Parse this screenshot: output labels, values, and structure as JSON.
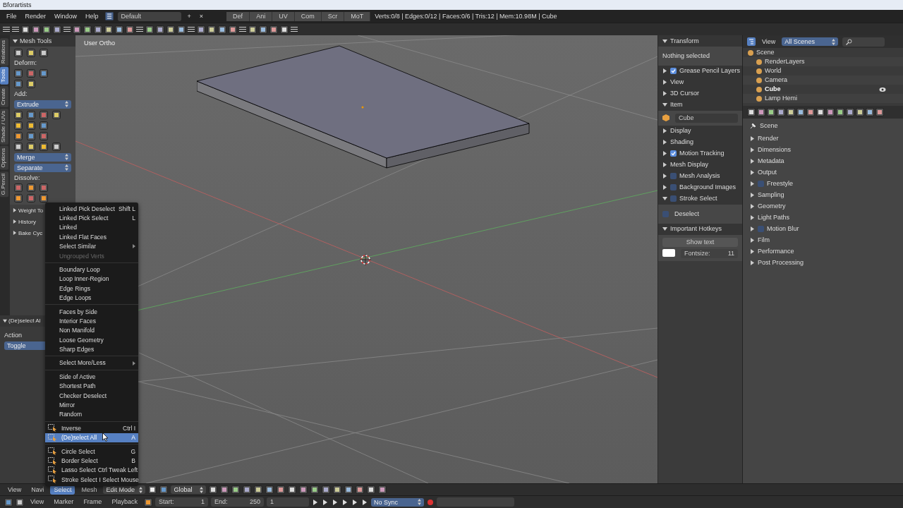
{
  "window": {
    "title": "Bforartists"
  },
  "menu_bar": {
    "menus": [
      "File",
      "Render",
      "Window",
      "Help"
    ],
    "layout": "Default",
    "layout_buttons": [
      "+",
      "×"
    ],
    "tabs": [
      {
        "label": "Def",
        "selected": false
      },
      {
        "label": "Ani",
        "selected": false
      },
      {
        "label": "UV",
        "selected": false
      },
      {
        "label": "Com",
        "selected": false
      },
      {
        "label": "Scr",
        "selected": false
      },
      {
        "label": "MoT",
        "selected": false
      }
    ],
    "stats": "Verts:0/8 | Edges:0/12 | Faces:0/6 | Tris:12 | Mem:10.98M | Cube"
  },
  "tool_shelf": {
    "tabs": [
      {
        "label": "Relations",
        "selected": false
      },
      {
        "label": "Tools",
        "selected": true
      },
      {
        "label": "Create",
        "selected": false
      },
      {
        "label": "Shade / UVs",
        "selected": false
      },
      {
        "label": "Options",
        "selected": false
      },
      {
        "label": "G.Pencil",
        "selected": false
      }
    ],
    "panel": {
      "title": "Mesh Tools",
      "expanded": true
    },
    "deform_label": "Deform:",
    "add_label": "Add:",
    "extrude": "Extrude",
    "merge": "Merge",
    "separate": "Separate",
    "dissolve_label": "Dissolve:",
    "collapsed_panels": [
      {
        "title": "Weight To",
        "expanded": false
      },
      {
        "title": "History",
        "expanded": false
      },
      {
        "title": "Bake Cyc",
        "expanded": false
      }
    ],
    "operator": {
      "title": "(De)select Al",
      "expanded": true,
      "action_label": "Action",
      "action": "Toggle"
    }
  },
  "viewport": {
    "label": "User Ortho"
  },
  "select_menu": {
    "groups": [
      [
        {
          "label": "Linked Pick Deselect",
          "shortcut": "Shift L",
          "kind": "command",
          "icon": false,
          "disabled": false,
          "selected": false
        },
        {
          "label": "Linked Pick Select",
          "shortcut": "L",
          "kind": "command",
          "icon": false,
          "disabled": false,
          "selected": false
        },
        {
          "label": "Linked",
          "kind": "command",
          "icon": false,
          "disabled": false,
          "selected": false
        },
        {
          "label": "Linked Flat Faces",
          "kind": "command",
          "icon": false,
          "disabled": false,
          "selected": false
        },
        {
          "label": "Select Similar",
          "kind": "submenu",
          "icon": false,
          "disabled": false,
          "selected": false
        },
        {
          "label": "Ungrouped Verts",
          "kind": "command",
          "icon": false,
          "disabled": true,
          "selected": false
        }
      ],
      [
        {
          "label": "Boundary Loop",
          "kind": "command",
          "icon": false,
          "disabled": false,
          "selected": false
        },
        {
          "label": "Loop Inner-Region",
          "kind": "command",
          "icon": false,
          "disabled": false,
          "selected": false
        },
        {
          "label": "Edge Rings",
          "kind": "command",
          "icon": false,
          "disabled": false,
          "selected": false
        },
        {
          "label": "Edge Loops",
          "kind": "command",
          "icon": false,
          "disabled": false,
          "selected": false
        }
      ],
      [
        {
          "label": "Faces by Side",
          "kind": "command",
          "icon": false,
          "disabled": false,
          "selected": false
        },
        {
          "label": "Interior Faces",
          "kind": "command",
          "icon": false,
          "disabled": false,
          "selected": false
        },
        {
          "label": "Non Manifold",
          "kind": "command",
          "icon": false,
          "disabled": false,
          "selected": false
        },
        {
          "label": "Loose Geometry",
          "kind": "command",
          "icon": false,
          "disabled": false,
          "selected": false
        },
        {
          "label": "Sharp Edges",
          "kind": "command",
          "icon": false,
          "disabled": false,
          "selected": false
        }
      ],
      [
        {
          "label": "Select More/Less",
          "kind": "submenu",
          "icon": false,
          "disabled": false,
          "selected": false
        }
      ],
      [
        {
          "label": "Side of Active",
          "kind": "command",
          "icon": false,
          "disabled": false,
          "selected": false
        },
        {
          "label": "Shortest Path",
          "kind": "command",
          "icon": false,
          "disabled": false,
          "selected": false
        },
        {
          "label": "Checker Deselect",
          "kind": "command",
          "icon": false,
          "disabled": false,
          "selected": false
        },
        {
          "label": "Mirror",
          "kind": "command",
          "icon": false,
          "disabled": false,
          "selected": false
        },
        {
          "label": "Random",
          "kind": "command",
          "icon": false,
          "disabled": false,
          "selected": false
        }
      ],
      [
        {
          "label": "Inverse",
          "shortcut": "Ctrl I",
          "kind": "command",
          "icon": true,
          "disabled": false,
          "selected": false
        },
        {
          "label": "(De)select All",
          "shortcut": "A",
          "kind": "command",
          "icon": true,
          "disabled": false,
          "selected": true
        }
      ],
      [
        {
          "label": "Circle Select",
          "shortcut": "G",
          "kind": "command",
          "icon": true,
          "disabled": false,
          "selected": false
        },
        {
          "label": "Border Select",
          "shortcut": "B",
          "kind": "command",
          "icon": true,
          "disabled": false,
          "selected": false
        },
        {
          "label": "Lasso Select",
          "shortcut": "Ctrl Tweak Left",
          "kind": "command",
          "icon": true,
          "disabled": false,
          "selected": false
        },
        {
          "label": "Stroke Select",
          "shortcut": "I Select Mouse",
          "kind": "command",
          "icon": true,
          "disabled": false,
          "selected": false
        }
      ]
    ]
  },
  "n_panel": {
    "panels": [
      {
        "title": "Transform",
        "expanded": true,
        "kind": "text",
        "text": "Nothing selected"
      },
      {
        "title": "Grease Pencil Layers",
        "expanded": false,
        "kind": "plain",
        "checked": true
      },
      {
        "title": "View",
        "expanded": false,
        "kind": "plain"
      },
      {
        "title": "3D Cursor",
        "expanded": false,
        "kind": "plain"
      },
      {
        "title": "Item",
        "expanded": true,
        "kind": "name",
        "value": "Cube"
      },
      {
        "title": "Display",
        "expanded": false,
        "kind": "plain"
      },
      {
        "title": "Shading",
        "expanded": false,
        "kind": "plain"
      },
      {
        "title": "Motion Tracking",
        "expanded": false,
        "kind": "plain",
        "checked": true
      },
      {
        "title": "Mesh Display",
        "expanded": false,
        "kind": "plain"
      },
      {
        "title": "Mesh Analysis",
        "expanded": false,
        "kind": "plain",
        "checked": false
      },
      {
        "title": "Background Images",
        "expanded": false,
        "kind": "plain",
        "checked": false
      },
      {
        "title": "Stroke Select",
        "expanded": true,
        "kind": "checkbox",
        "label": "Deselect",
        "checked": false
      },
      {
        "title": "Important Hotkeys",
        "expanded": true,
        "kind": "hotkeys",
        "button": "Show text",
        "field_label": "Fontsize:",
        "field_value": "11"
      }
    ]
  },
  "outliner": {
    "view": "View",
    "scenes": "All Scenes",
    "tree": [
      {
        "label": "Scene",
        "selected": false,
        "children": [
          {
            "label": "RenderLayers",
            "selected": false
          },
          {
            "label": "World",
            "selected": false
          },
          {
            "label": "Camera",
            "selected": false
          },
          {
            "label": "Cube",
            "selected": true
          },
          {
            "label": "Lamp Hemi",
            "selected": false
          }
        ]
      }
    ]
  },
  "properties": {
    "breadcrumb": "Scene",
    "panels": [
      {
        "title": "Render",
        "expanded": false
      },
      {
        "title": "Dimensions",
        "expanded": false
      },
      {
        "title": "Metadata",
        "expanded": false
      },
      {
        "title": "Output",
        "expanded": false
      },
      {
        "title": "Freestyle",
        "expanded": false,
        "checked": false
      },
      {
        "title": "Sampling",
        "expanded": false
      },
      {
        "title": "Geometry",
        "expanded": false
      },
      {
        "title": "Light Paths",
        "expanded": false
      },
      {
        "title": "Motion Blur",
        "expanded": false,
        "checked": false
      },
      {
        "title": "Film",
        "expanded": false
      },
      {
        "title": "Performance",
        "expanded": false
      },
      {
        "title": "Post Processing",
        "expanded": false
      }
    ]
  },
  "view3d_header": {
    "menus": [
      {
        "label": "View",
        "selected": false
      },
      {
        "label": "Navi",
        "selected": false
      },
      {
        "label": "Select",
        "selected": true
      },
      {
        "label": "Mesh",
        "selected": false
      }
    ],
    "mode": "Edit Mode",
    "orientation": "Global"
  },
  "timeline": {
    "menus": [
      "View",
      "Marker",
      "Frame",
      "Playback"
    ],
    "start_label": "Start:",
    "start": "1",
    "end_label": "End:",
    "end": "250",
    "frame": "1",
    "sync": "No Sync"
  }
}
